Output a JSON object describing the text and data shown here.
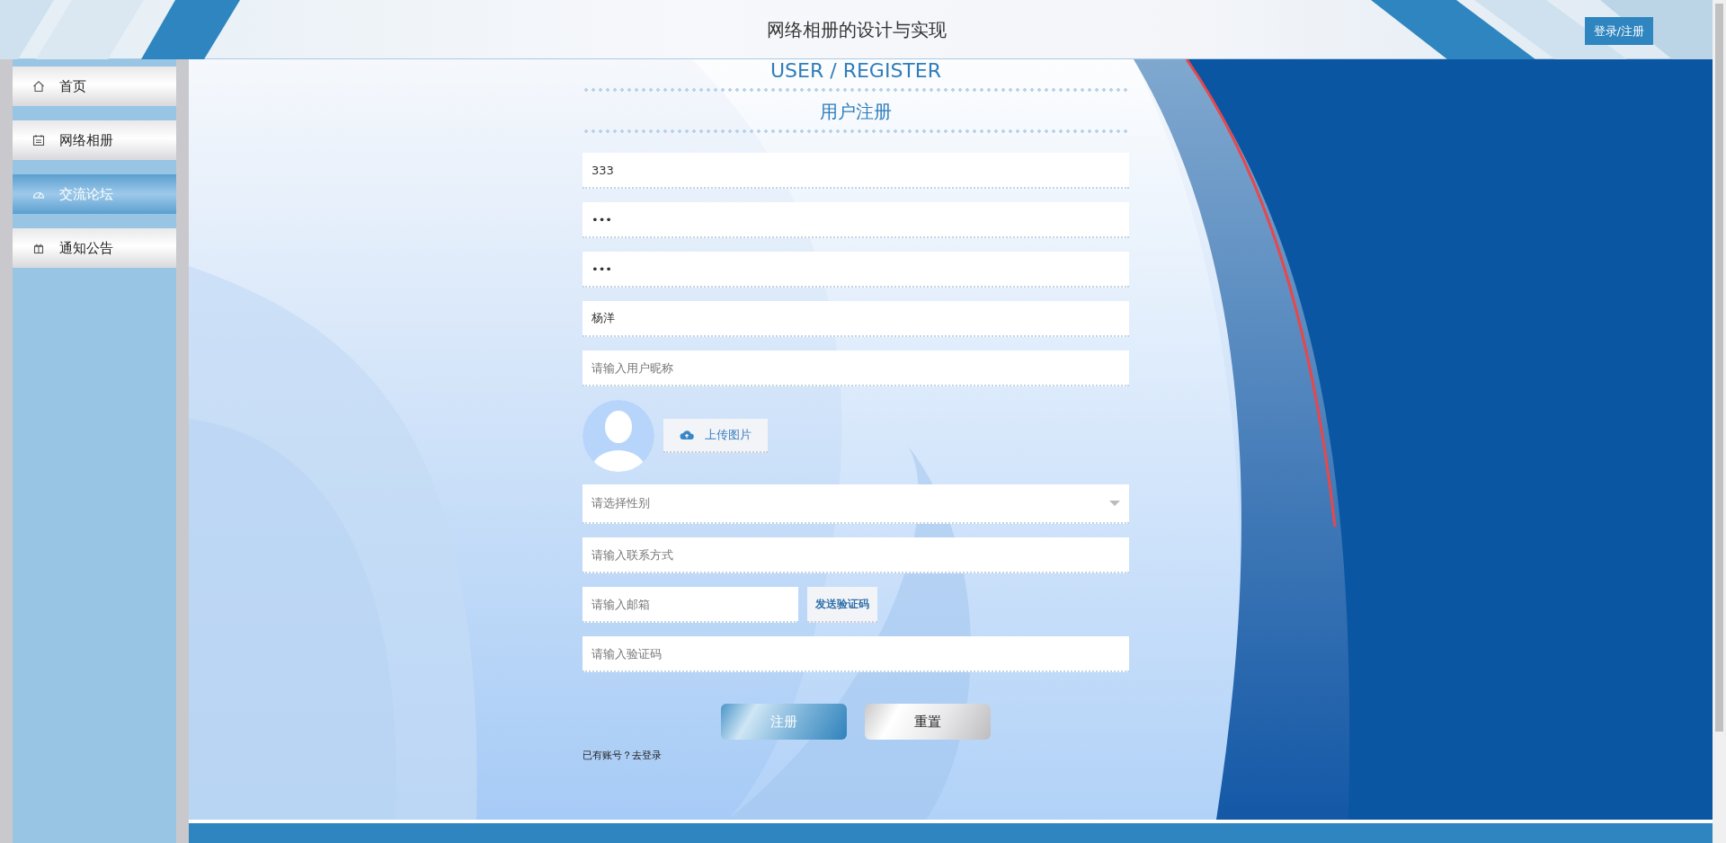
{
  "header": {
    "title": "网络相册的设计与实现",
    "login_button": "登录/注册"
  },
  "sidebar": {
    "items": [
      {
        "label": "首页",
        "kind": "home",
        "selected": false
      },
      {
        "label": "网络相册",
        "kind": "calendar",
        "selected": false
      },
      {
        "label": "交流论坛",
        "kind": "gauge",
        "selected": true
      },
      {
        "label": "通知公告",
        "kind": "gift",
        "selected": false
      }
    ]
  },
  "form": {
    "title_en": "USER / REGISTER",
    "title_cn": "用户注册",
    "fields": [
      {
        "kind": "input",
        "value": "333"
      },
      {
        "kind": "input",
        "value": "•••"
      },
      {
        "kind": "input",
        "value": "•••"
      },
      {
        "kind": "input",
        "value": "杨洋"
      },
      {
        "kind": "input",
        "placeholder": "请输入用户昵称"
      },
      {
        "kind": "avatar",
        "button": "上传图片"
      },
      {
        "kind": "select",
        "placeholder": "请选择性别"
      },
      {
        "kind": "input",
        "placeholder": "请输入联系方式"
      },
      {
        "kind": "input_button",
        "placeholder": "请输入邮箱",
        "button": "发送验证码"
      },
      {
        "kind": "input",
        "placeholder": "请输入验证码"
      }
    ],
    "buttons": [
      {
        "label": "注册",
        "kind": "primary"
      },
      {
        "label": "重置",
        "kind": "secondary"
      }
    ],
    "login_prompt": "已有账号？",
    "login_link": "去登录"
  }
}
